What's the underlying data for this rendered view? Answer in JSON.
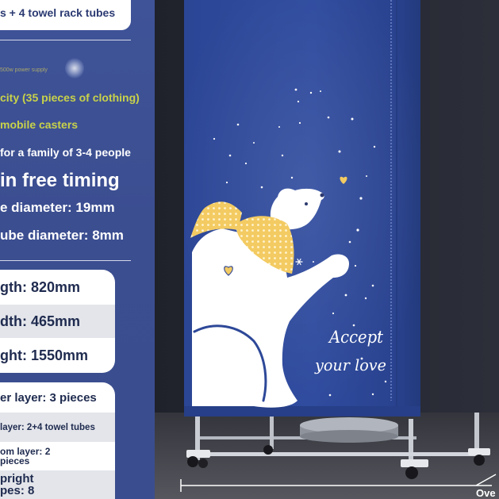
{
  "left_panel": {
    "top_box": "s + 4 towel rack tubes",
    "features": {
      "power": "500w power supply",
      "capacity": "city (35 pieces of clothing)",
      "casters": "mobile casters",
      "family": "for a family of 3-4 people",
      "timing": "in free timing",
      "main_tube_diameter": "e diameter: 19mm",
      "small_tube_diameter": "ube diameter: 8mm"
    },
    "dimensions": {
      "length": "gth: 820mm",
      "width": "dth: 465mm",
      "height": "ght: 1550mm"
    },
    "layers": {
      "upper": "er layer: 3 pieces",
      "middle": "layer: 2+4 towel tubes",
      "bottom_line1": "om layer: 2",
      "bottom_line2": "pieces",
      "upright_line1": "pright",
      "upright_line2": "pes: 8"
    }
  },
  "product": {
    "slogan_line1": "Accept",
    "slogan_line2": "your love"
  },
  "dimension_label": "Ove",
  "colors": {
    "panel_blue": "#3b4e90",
    "accent_yellow_green": "#c8d24a",
    "cover_blue": "#2d4898",
    "scarf_yellow": "#f3cb62",
    "text_dark": "#1f2b4f"
  }
}
